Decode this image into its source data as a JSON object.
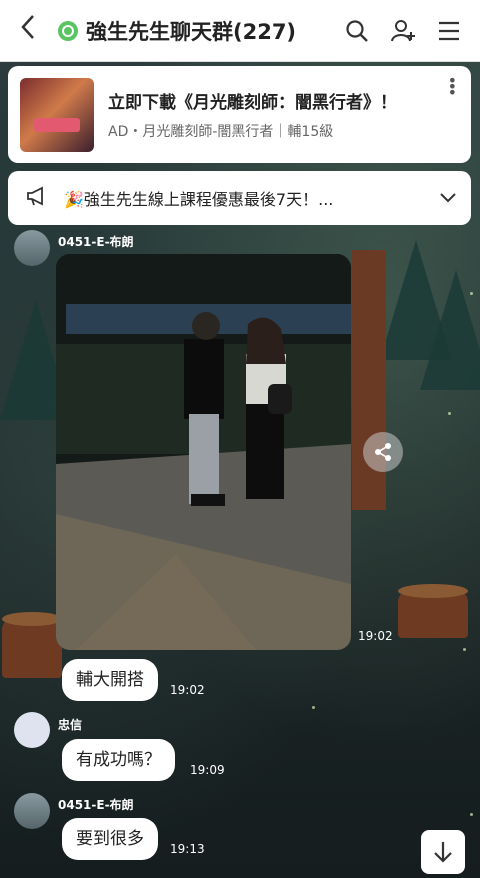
{
  "header": {
    "back_icon": "chevron-left-icon",
    "title": "強生先生聊天群(227)",
    "icons": [
      "search-icon",
      "add-user-icon",
      "menu-icon"
    ]
  },
  "ad": {
    "title": "立即下載《月光雕刻師：闇黑行者》！",
    "subtitle": "AD・月光雕刻師-闇黑行者｜輔15級"
  },
  "announcement": {
    "icon": "megaphone-icon",
    "text": "🎉強生先生線上課程優惠最後7天！..."
  },
  "messages": [
    {
      "sender": "0451-E-布朗",
      "type": "photo",
      "time": "19:02"
    },
    {
      "sender": "",
      "type": "text",
      "text": "輔大開搭",
      "time": "19:02"
    },
    {
      "sender": "忠信",
      "type": "text",
      "text": "有成功嗎？",
      "time": "19:09"
    },
    {
      "sender": "0451-E-布朗",
      "type": "text",
      "text": "要到很多",
      "time": "19:13"
    }
  ]
}
